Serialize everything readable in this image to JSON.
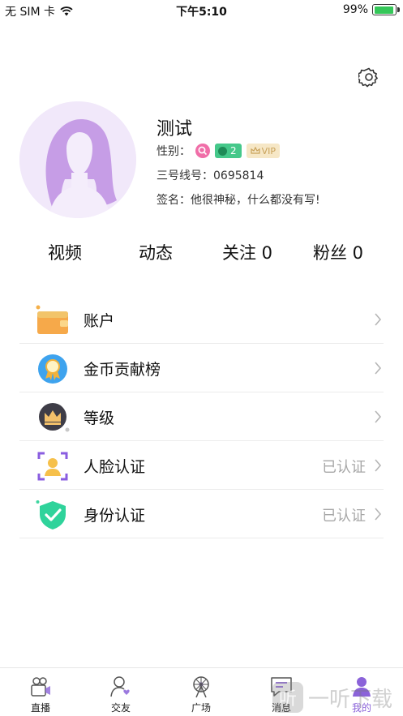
{
  "status_bar": {
    "carrier": "无 SIM 卡",
    "time": "下午5:10",
    "battery_percent": "99%",
    "battery_level": 0.99
  },
  "profile": {
    "name": "测试",
    "gender_label": "性别：",
    "level_value": "2",
    "vip_label": "VIP",
    "line_id": "三号线号：0695814",
    "signature": "签名：他很神秘，什么都没有写!"
  },
  "stats": {
    "video": "视频",
    "moments": "动态",
    "following": "关注 0",
    "fans": "粉丝 0"
  },
  "menu": {
    "items": [
      {
        "label": "账户",
        "status": "",
        "icon": "wallet-icon"
      },
      {
        "label": "金币贡献榜",
        "status": "",
        "icon": "medal-icon"
      },
      {
        "label": "等级",
        "status": "",
        "icon": "crown-icon"
      },
      {
        "label": "人脸认证",
        "status": "已认证",
        "icon": "face-scan-icon"
      },
      {
        "label": "身份认证",
        "status": "已认证",
        "icon": "shield-check-icon"
      }
    ]
  },
  "tabs": [
    {
      "label": "直播",
      "icon": "video-camera-icon",
      "active": false
    },
    {
      "label": "交友",
      "icon": "friends-icon",
      "active": false
    },
    {
      "label": "广场",
      "icon": "ferris-wheel-icon",
      "active": false
    },
    {
      "label": "消息",
      "icon": "message-icon",
      "active": false
    },
    {
      "label": "我的",
      "icon": "profile-icon",
      "active": true
    }
  ],
  "watermark": {
    "icon_text": "听",
    "text": "一听下载"
  },
  "colors": {
    "accent": "#8b63d9",
    "level_badge": "#45c88a",
    "vip_badge": "#f6e7c6",
    "gender_female": "#f06ea8",
    "verified_text": "#a7a7a7"
  }
}
